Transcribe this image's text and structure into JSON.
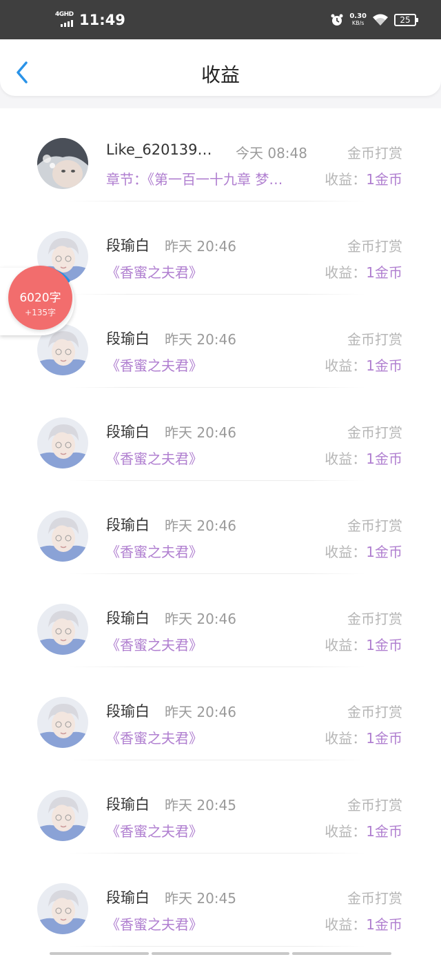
{
  "status_bar": {
    "network": "4GHD",
    "time": "11:49",
    "speed_value": "0.30",
    "speed_unit": "KB/s",
    "battery": "25"
  },
  "header": {
    "title": "收益",
    "back_icon": "chevron-left-icon"
  },
  "colors": {
    "accent": "#b07fd0",
    "back": "#2a93e8",
    "bubble": "#f26d6d"
  },
  "word_counter": {
    "count": "6020字",
    "delta": "+135字"
  },
  "records": [
    {
      "name": "Like_620139…",
      "time": "今天 08:48",
      "type": "金币打赏",
      "chapter": "章节：《第一百一十九章 梦…",
      "income_label": "收益：",
      "income_value": "1金币",
      "avatar": "avatar-dark-hair"
    },
    {
      "name": "段瑜白",
      "time": "昨天 20:46",
      "type": "金币打赏",
      "chapter": "《香蜜之夫君》",
      "income_label": "收益：",
      "income_value": "1金币",
      "avatar": "avatar-silver-hair"
    },
    {
      "name": "段瑜白",
      "time": "昨天 20:46",
      "type": "金币打赏",
      "chapter": "《香蜜之夫君》",
      "income_label": "收益：",
      "income_value": "1金币",
      "avatar": "avatar-silver-hair"
    },
    {
      "name": "段瑜白",
      "time": "昨天 20:46",
      "type": "金币打赏",
      "chapter": "《香蜜之夫君》",
      "income_label": "收益：",
      "income_value": "1金币",
      "avatar": "avatar-silver-hair"
    },
    {
      "name": "段瑜白",
      "time": "昨天 20:46",
      "type": "金币打赏",
      "chapter": "《香蜜之夫君》",
      "income_label": "收益：",
      "income_value": "1金币",
      "avatar": "avatar-silver-hair"
    },
    {
      "name": "段瑜白",
      "time": "昨天 20:46",
      "type": "金币打赏",
      "chapter": "《香蜜之夫君》",
      "income_label": "收益：",
      "income_value": "1金币",
      "avatar": "avatar-silver-hair"
    },
    {
      "name": "段瑜白",
      "time": "昨天 20:46",
      "type": "金币打赏",
      "chapter": "《香蜜之夫君》",
      "income_label": "收益：",
      "income_value": "1金币",
      "avatar": "avatar-silver-hair"
    },
    {
      "name": "段瑜白",
      "time": "昨天 20:45",
      "type": "金币打赏",
      "chapter": "《香蜜之夫君》",
      "income_label": "收益：",
      "income_value": "1金币",
      "avatar": "avatar-silver-hair"
    },
    {
      "name": "段瑜白",
      "time": "昨天 20:45",
      "type": "金币打赏",
      "chapter": "《香蜜之夫君》",
      "income_label": "收益：",
      "income_value": "1金币",
      "avatar": "avatar-silver-hair"
    }
  ]
}
